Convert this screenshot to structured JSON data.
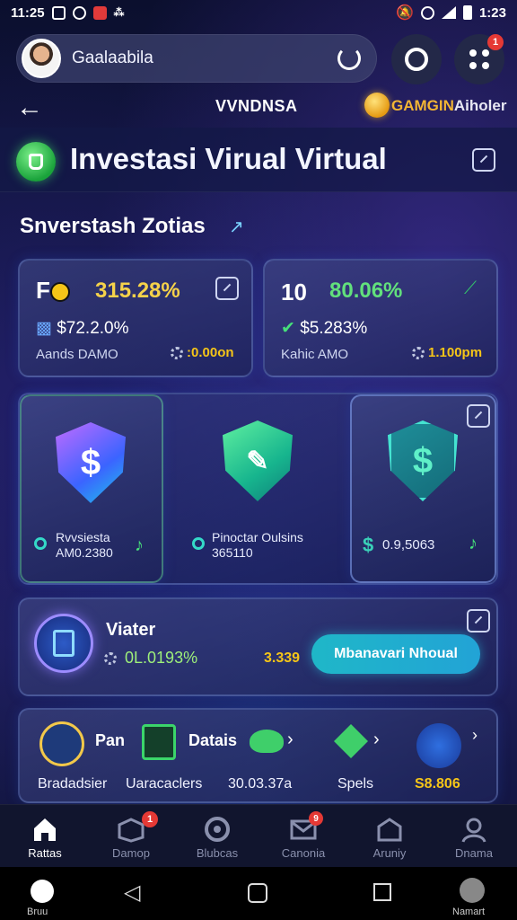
{
  "status_bar": {
    "time_left": "11:25",
    "time_right": "1:23"
  },
  "search": {
    "text": "Gaalaabila"
  },
  "badges": {
    "menu": "1",
    "tab_2": "1",
    "tab_4": "9"
  },
  "nav": {
    "title": "VVNDNSA",
    "account_gold": "GAMGIN",
    "account_rest": "Aiholer"
  },
  "header": {
    "title": "Investasi Virual Virtual"
  },
  "section": {
    "title": "Snverstash Zotias"
  },
  "stats": [
    {
      "icon_text": "F",
      "pct": "315.28%",
      "sub": "$72.2.0%",
      "label": "Aands DAMO",
      "value": ":0.00on",
      "pct_color": "#f5d24a",
      "value_color": "#f5c518"
    },
    {
      "icon_text": "10",
      "pct": "80.06%",
      "sub": "$5.283%",
      "label": "Kahic AMO",
      "value": "1.100pm",
      "pct_color": "#62e07c",
      "value_color": "#f5c518"
    }
  ],
  "shields": [
    {
      "label_1": "Rvvsiesta",
      "label_2": "AM0.2380"
    },
    {
      "label_1": "Pinoctar Oulsins",
      "label_2": "365110"
    },
    {
      "label_1": "0.9,5063",
      "label_2": ""
    }
  ],
  "action": {
    "title": "Viater",
    "pct": "0L.0193%",
    "value": "3.339",
    "button": "Mbanavari Nhoual"
  },
  "strip": {
    "icon1_text": "Pan",
    "icon2_text": "Datais",
    "label_1": "Bradadsier",
    "label_2": "Uaracaclers",
    "label_3": "30.03.37a",
    "label_4": "Spels",
    "label_5": "S8.806"
  },
  "tabs": [
    "Rattas",
    "Damop",
    "Blubcas",
    "Canonia",
    "Aruniy",
    "Dnama"
  ],
  "system_nav": {
    "home_label": "Bruu",
    "right_label": "Namart"
  },
  "colors": {
    "accent_green": "#62e07c",
    "accent_gold": "#f5c518",
    "accent_cyan": "#22a3d6"
  }
}
